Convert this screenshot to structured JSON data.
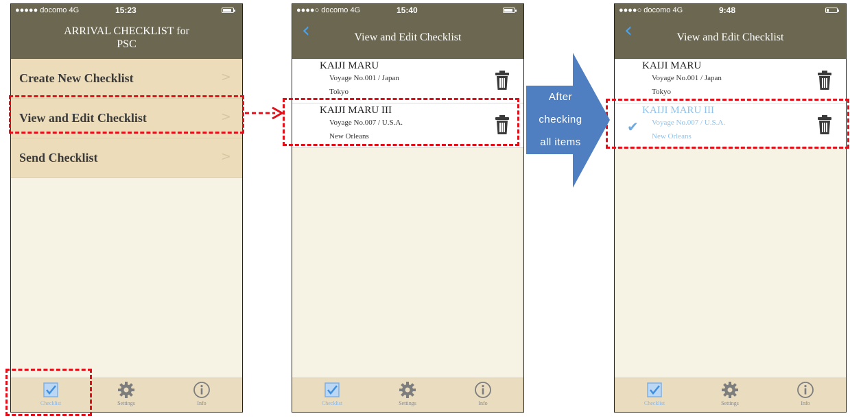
{
  "status": {
    "s1": {
      "carrier": "●●●●● docomo  4G",
      "time": "15:23"
    },
    "s2": {
      "carrier": "●●●●○ docomo  4G",
      "time": "15:40"
    },
    "s3": {
      "carrier": "●●●●○ docomo  4G",
      "time": "9:48"
    }
  },
  "screen1": {
    "title_line1": "ARRIVAL CHECKLIST for",
    "title_line2": "PSC",
    "menu": [
      {
        "label": "Create New Checklist",
        "chevron": ">"
      },
      {
        "label": "View and Edit Checklist",
        "chevron": ">"
      },
      {
        "label": "Send Checklist",
        "chevron": ">"
      }
    ]
  },
  "screen2": {
    "back": "‹",
    "title": "View and Edit Checklist",
    "rows": [
      {
        "ship": "KAIJI MARU",
        "voyage": "Voyage No.001 / Japan",
        "city": "Tokyo"
      },
      {
        "ship": "KAIJI MARU III",
        "voyage": "Voyage No.007 / U.S.A.",
        "city": "New Orleans"
      }
    ]
  },
  "screen3": {
    "back": "‹",
    "title": "View and Edit Checklist",
    "rows": [
      {
        "ship": "KAIJI MARU",
        "voyage": "Voyage No.001 / Japan",
        "city": "Tokyo"
      },
      {
        "ship": "KAIJI MARU III",
        "voyage": "Voyage No.007 / U.S.A.",
        "city": "New Orleans",
        "check": "✔"
      }
    ]
  },
  "tabs": {
    "checklist": "Checklist",
    "settings": "Settings",
    "info": "Info"
  },
  "arrow": {
    "line1": "After",
    "line2": "checking",
    "line3": "all items"
  },
  "connector": {
    "arrowhead": "➔"
  },
  "colors": {
    "nav": "#6b6750",
    "menu_bg": "#ecdcb9",
    "highlight": "#e0101a",
    "arrow": "#4f7fc0",
    "accent": "#4aa3f0"
  }
}
